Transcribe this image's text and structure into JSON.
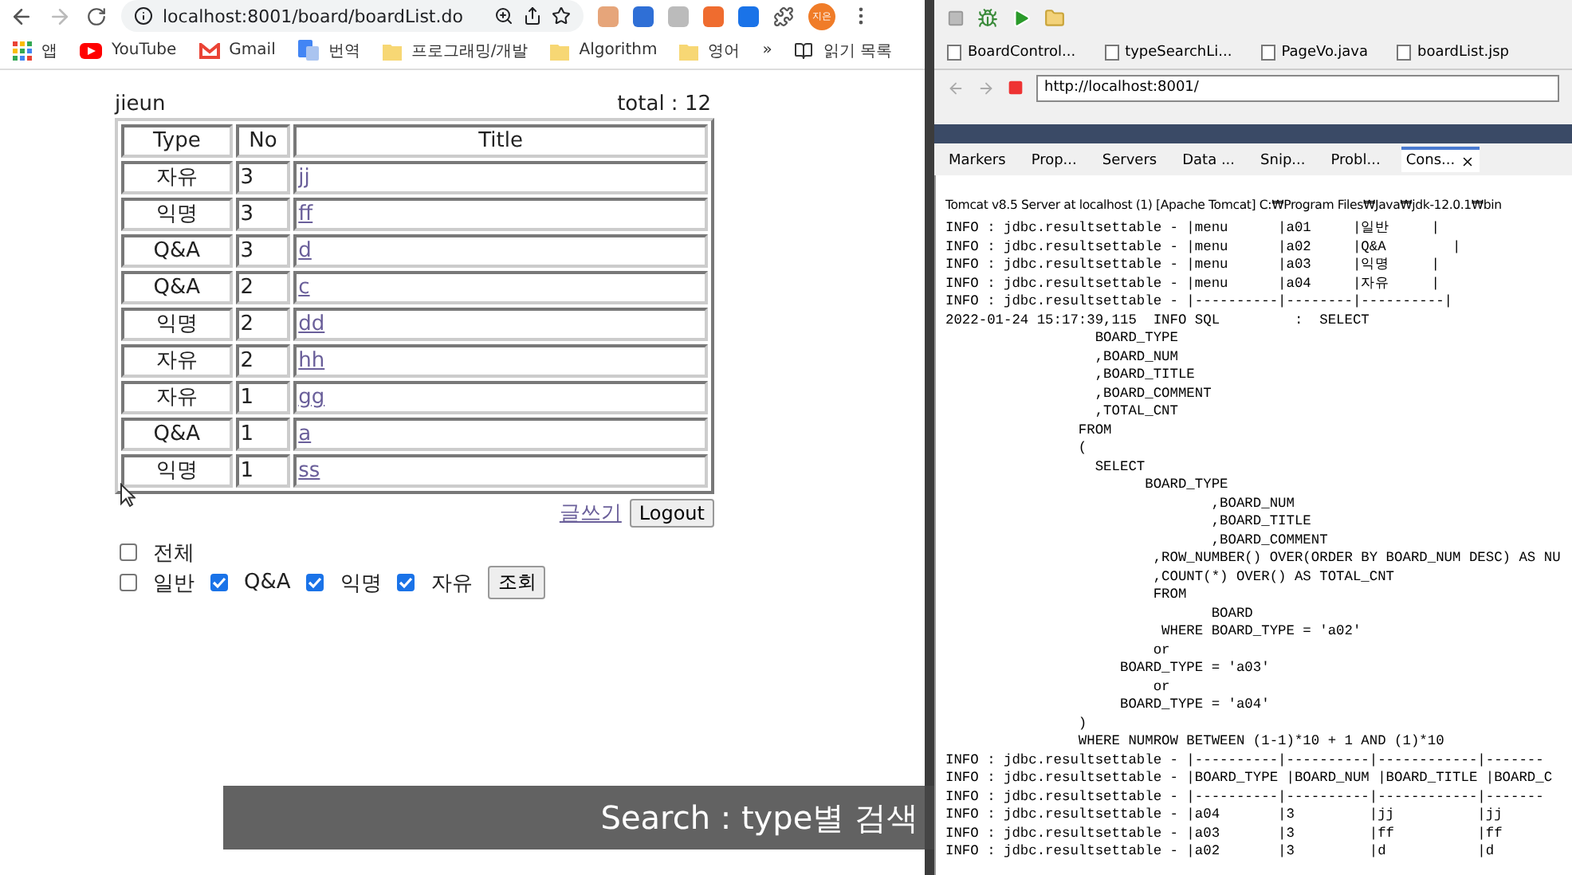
{
  "browser": {
    "url": "localhost:8001/board/boardList.do",
    "avatar": "지은",
    "bookmarks": [
      {
        "label": "앱",
        "kind": "apps"
      },
      {
        "label": "YouTube",
        "kind": "youtube"
      },
      {
        "label": "Gmail",
        "kind": "gmail"
      },
      {
        "label": "번역",
        "kind": "translate"
      },
      {
        "label": "프로그래밍/개발",
        "kind": "folder"
      },
      {
        "label": "Algorithm",
        "kind": "folder"
      },
      {
        "label": "영어",
        "kind": "folder"
      }
    ],
    "more": "»",
    "reading_list": "읽기 목록"
  },
  "page": {
    "user": "jieun",
    "total": "total : 12",
    "columns": [
      "Type",
      "No",
      "Title"
    ],
    "rows": [
      {
        "type": "자유",
        "no": "3",
        "title": "jj"
      },
      {
        "type": "익명",
        "no": "3",
        "title": "ff"
      },
      {
        "type": "Q&A",
        "no": "3",
        "title": "d"
      },
      {
        "type": "Q&A",
        "no": "2",
        "title": "c"
      },
      {
        "type": "익명",
        "no": "2",
        "title": "dd"
      },
      {
        "type": "자유",
        "no": "2",
        "title": "hh"
      },
      {
        "type": "자유",
        "no": "1",
        "title": "gg"
      },
      {
        "type": "Q&A",
        "no": "1",
        "title": "a"
      },
      {
        "type": "익명",
        "no": "1",
        "title": "ss"
      }
    ],
    "write_link": "글쓰기",
    "logout": "Logout",
    "all_filter": {
      "label": "전체",
      "checked": false
    },
    "type_filters": [
      {
        "label": "일반",
        "checked": false
      },
      {
        "label": "Q&A",
        "checked": true
      },
      {
        "label": "익명",
        "checked": true
      },
      {
        "label": "자유",
        "checked": true
      }
    ],
    "search_button": "조회"
  },
  "ide": {
    "editor_tabs": [
      "BoardControl...",
      "typeSearchLi...",
      "PageVo.java",
      "boardList.jsp"
    ],
    "url": "http://localhost:8001/",
    "views": [
      {
        "label": "Markers",
        "selected": false
      },
      {
        "label": "Prop...",
        "selected": false
      },
      {
        "label": "Servers",
        "selected": false
      },
      {
        "label": "Data ...",
        "selected": false
      },
      {
        "label": "Snip...",
        "selected": false
      },
      {
        "label": "Probl...",
        "selected": false
      },
      {
        "label": "Cons...",
        "selected": true
      }
    ],
    "console_title": "Tomcat v8.5 Server at localhost (1) [Apache Tomcat] C:₩Program Files₩Java₩jdk-12.0.1₩bin",
    "console_lines": [
      "INFO : jdbc.resultsettable - |menu      |a01     |일반     |",
      "INFO : jdbc.resultsettable - |menu      |a02     |Q&A        |",
      "INFO : jdbc.resultsettable - |menu      |a03     |익명     |",
      "INFO : jdbc.resultsettable - |menu      |a04     |자유     |",
      "INFO : jdbc.resultsettable - |----------|--------|----------|",
      "2022-01-24 15:17:39,115  INFO SQL         :  SELECT",
      "                  BOARD_TYPE",
      "                  ,BOARD_NUM",
      "                  ,BOARD_TITLE",
      "                  ,BOARD_COMMENT",
      "                  ,TOTAL_CNT",
      "                FROM",
      "                (",
      "                  SELECT",
      "                        BOARD_TYPE",
      "                                ,BOARD_NUM",
      "                                ,BOARD_TITLE",
      "                                ,BOARD_COMMENT",
      "                         ,ROW_NUMBER() OVER(ORDER BY BOARD_NUM DESC) AS NU",
      "                         ,COUNT(*) OVER() AS TOTAL_CNT",
      "                         FROM",
      "                                BOARD",
      "                          WHERE BOARD_TYPE = 'a02'",
      "                         or",
      "                     BOARD_TYPE = 'a03'",
      "                         or",
      "                     BOARD_TYPE = 'a04'",
      "                )",
      "                WHERE NUMROW BETWEEN (1-1)*10 + 1 AND (1)*10",
      "INFO : jdbc.resultsettable - |----------|----------|------------|-------",
      "INFO : jdbc.resultsettable - |BOARD_TYPE |BOARD_NUM |BOARD_TITLE |BOARD_C",
      "INFO : jdbc.resultsettable - |----------|----------|------------|-------",
      "INFO : jdbc.resultsettable - |a04       |3         |jj          |jj",
      "INFO : jdbc.resultsettable - |a03       |3         |ff          |ff",
      "INFO : jdbc.resultsettable - |a02       |3         |d           |d"
    ]
  },
  "caption": "Search : type별 검색"
}
